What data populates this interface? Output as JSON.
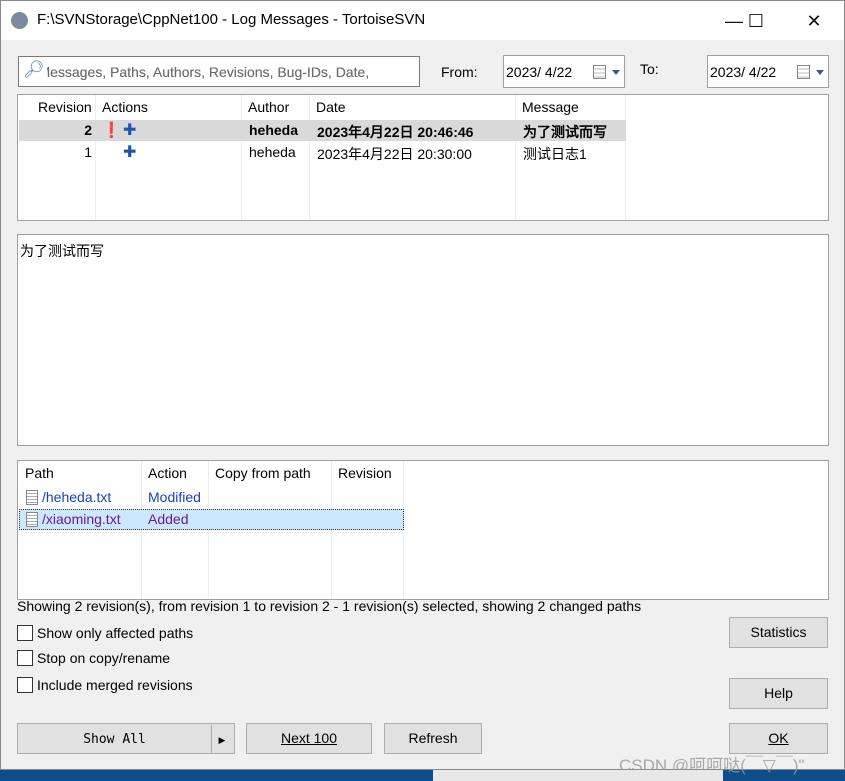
{
  "window": {
    "title": "F:\\SVNStorage\\CppNet100 - Log Messages - TortoiseSVN",
    "minimize": "—",
    "maximize": "☐",
    "close": "✕"
  },
  "filter": {
    "placeholder": "Messages, Paths, Authors, Revisions, Bug-IDs, Date,",
    "value": "",
    "display": "lessages, Paths, Authors, Revisions, Bug-IDs, Date,",
    "from_label": "From:",
    "from_value": "2023/  4/22",
    "to_label": "To:",
    "to_value": "2023/  4/22"
  },
  "log": {
    "columns": [
      "Revision",
      "Actions",
      "Author",
      "Date",
      "Message"
    ],
    "rows": [
      {
        "revision": "2",
        "actions": [
          "modified",
          "added"
        ],
        "author": "heheda",
        "date": "2023年4月22日 20:46:46",
        "message": "为了测试而写",
        "selected": true
      },
      {
        "revision": "1",
        "actions": [
          "added"
        ],
        "author": "heheda",
        "date": "2023年4月22日 20:30:00",
        "message": "测试日志1",
        "selected": false
      }
    ]
  },
  "message_text": "为了测试而写",
  "paths": {
    "columns": [
      "Path",
      "Action",
      "Copy from path",
      "Revision"
    ],
    "rows": [
      {
        "path": "/heheda.txt",
        "action": "Modified",
        "copy_from": "",
        "revision": "",
        "color": "#1a3fbf"
      },
      {
        "path": "/xiaoming.txt",
        "action": "Added",
        "copy_from": "",
        "revision": "",
        "color": "#6a1a8a",
        "selected": true
      }
    ]
  },
  "status": "Showing 2 revision(s), from revision 1 to revision 2 - 1 revision(s) selected, showing 2 changed paths",
  "options": [
    {
      "label": "Show only affected paths",
      "checked": false
    },
    {
      "label": "Stop on copy/rename",
      "checked": false
    },
    {
      "label": "Include merged revisions",
      "checked": false
    }
  ],
  "buttons": {
    "statistics": "Statistics",
    "help": "Help",
    "show_all": "Show All",
    "next100": "Next 100",
    "refresh": "Refresh",
    "ok": "OK"
  },
  "watermark": "CSDN @呵呵哒(￣▽￣)\""
}
